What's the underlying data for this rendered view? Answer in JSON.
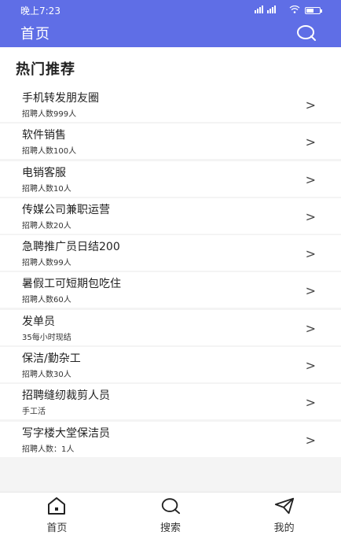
{
  "status_bar": {
    "time": "晚上7:23",
    "signal": "ᵛᵒˡᵗᵉ",
    "battery_icon": "battery-icon"
  },
  "header": {
    "title": "首页",
    "search_icon": "search-icon",
    "bg_color": "#5f6ee6"
  },
  "section": {
    "title": "热门推荐"
  },
  "list": [
    {
      "title": "手机转发朋友圈",
      "sub": "招聘人数999人"
    },
    {
      "title": "软件销售",
      "sub": "招聘人数100人"
    },
    {
      "title": "电销客服",
      "sub": "招聘人数10人"
    },
    {
      "title": "传媒公司兼职运营",
      "sub": "招聘人数20人"
    },
    {
      "title": "急聘推广员日结200",
      "sub": "招聘人数99人"
    },
    {
      "title": "暑假工可短期包吃住",
      "sub": "招聘人数60人"
    },
    {
      "title": "发单员",
      "sub": "35每小时现结"
    },
    {
      "title": "保洁/勤杂工",
      "sub": "招聘人数30人"
    },
    {
      "title": "招聘缝纫裁剪人员",
      "sub": "手工活"
    },
    {
      "title": "写字楼大堂保洁员",
      "sub": "招聘人数：1人"
    }
  ],
  "tabbar": [
    {
      "label": "首页",
      "icon": "home-icon"
    },
    {
      "label": "搜索",
      "icon": "search-icon"
    },
    {
      "label": "我的",
      "icon": "send-icon"
    }
  ]
}
